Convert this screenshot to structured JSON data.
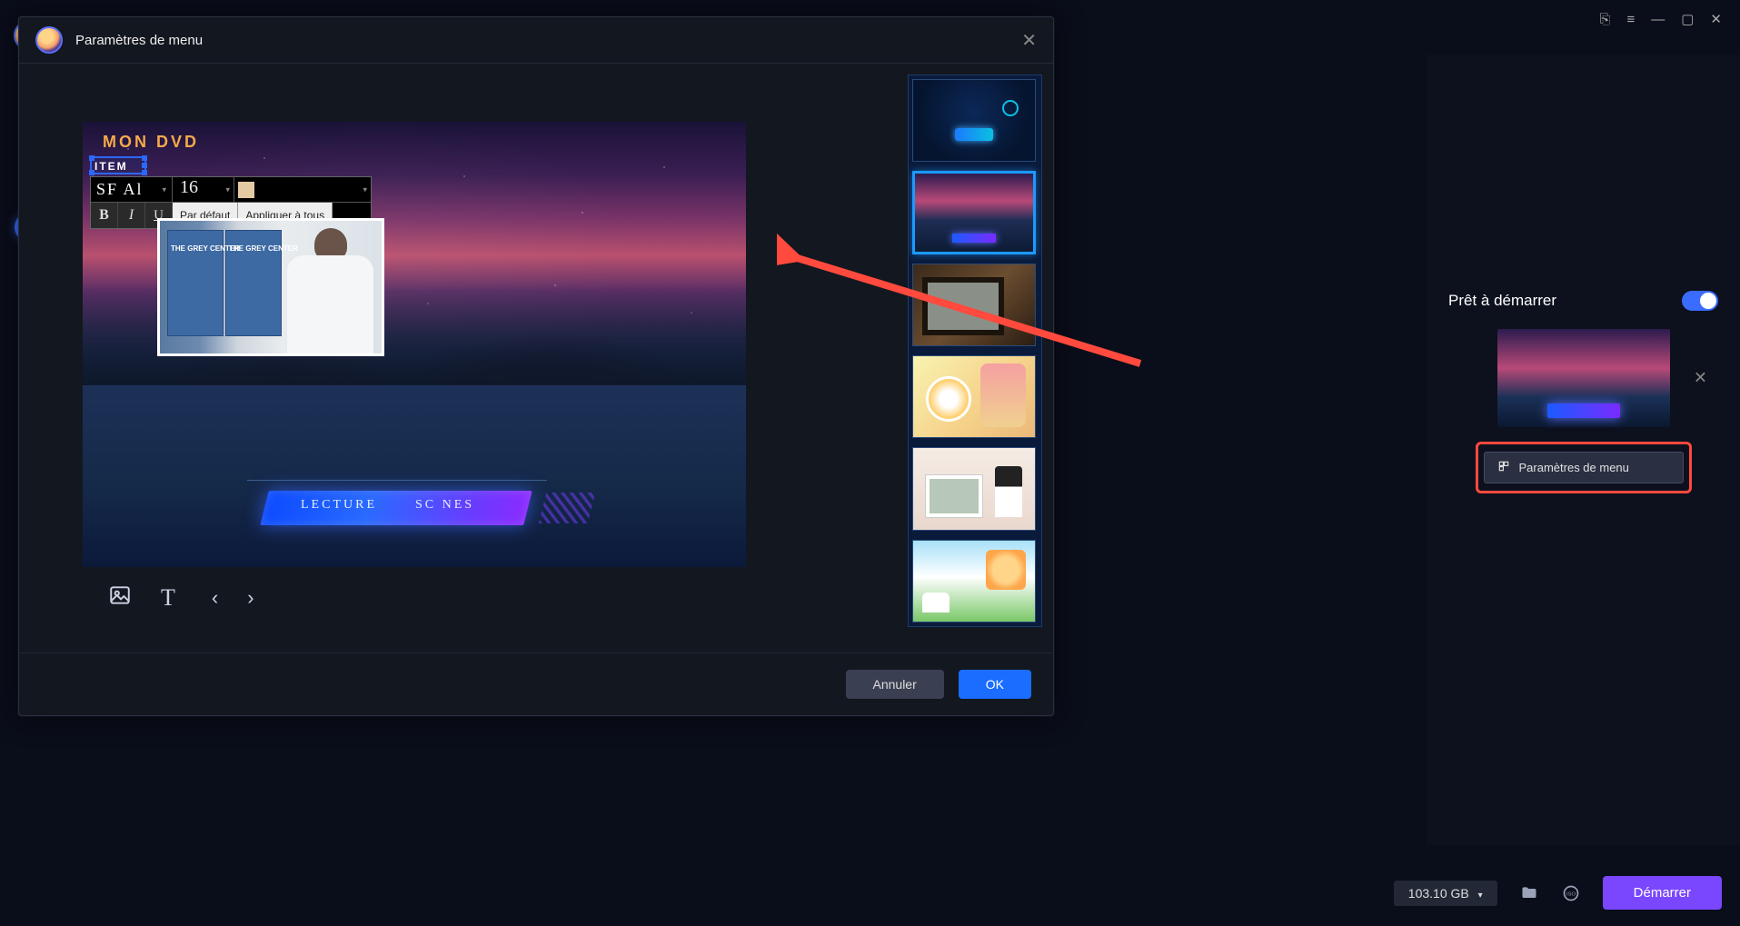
{
  "window": {
    "title": "Paramètres de menu"
  },
  "preview": {
    "dvd_title": "MON DVD",
    "item_label": "ITEM",
    "play_label": "LECTURE",
    "scenes_label": "SC NES",
    "clip_sign": "THE GREY\nCENTER"
  },
  "text_toolbar": {
    "font_name": "SF Al",
    "font_size": "16",
    "bold": "B",
    "italic": "I",
    "underline": "U",
    "default_btn": "Par défaut",
    "apply_all_btn": "Appliquer à tous"
  },
  "modal_footer": {
    "cancel": "Annuler",
    "ok": "OK"
  },
  "right_panel": {
    "ready_label": "Prêt à démarrer",
    "menu_settings_btn": "Paramètres de menu"
  },
  "bottom_bar": {
    "disk_size": "103.10 GB",
    "start_btn": "Démarrer"
  },
  "template_thumbs": [
    "tech-blue",
    "nebula",
    "film-reel",
    "floral",
    "wedding",
    "kids"
  ],
  "colors": {
    "accent_blue": "#1a6dff",
    "accent_purple": "#7a47ff",
    "annotation_red": "#ff4a3d"
  }
}
